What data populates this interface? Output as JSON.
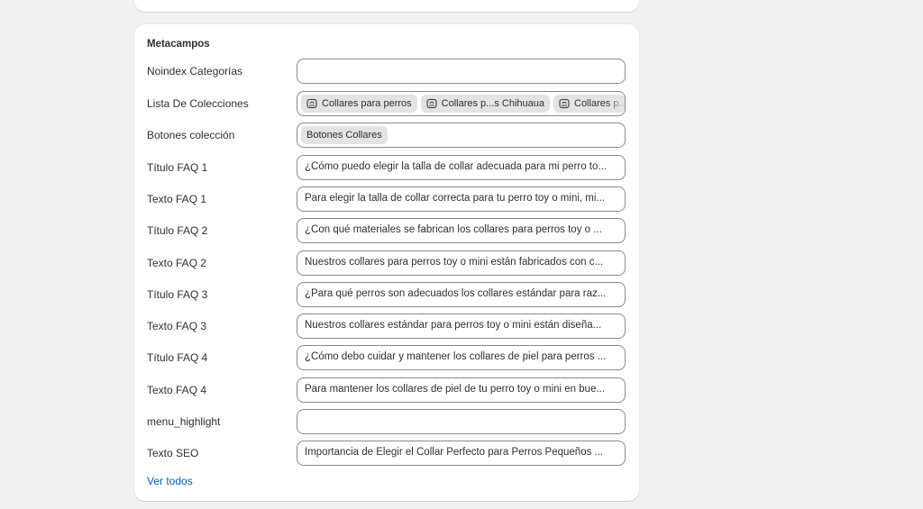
{
  "metafields": {
    "title": "Metacampos",
    "noindex": {
      "label": "Noindex Categorías",
      "value": ""
    },
    "collections": {
      "label": "Lista De Colecciones",
      "chips": [
        "Collares para perros",
        "Collares p...s Chihuaua",
        "Collares p..."
      ]
    },
    "buttons": {
      "label": "Botones colección",
      "chips": [
        "Botones Collares"
      ]
    },
    "faq": [
      {
        "label": "Título FAQ 1",
        "value": "¿Cómo puedo elegir la talla de collar adecuada para mi perro to..."
      },
      {
        "label": "Texto FAQ 1",
        "value": "Para elegir la talla de collar correcta para tu perro toy o mini, mi..."
      },
      {
        "label": "Título FAQ 2",
        "value": "¿Con qué materiales se fabrican los collares para perros toy o ..."
      },
      {
        "label": "Texto FAQ 2",
        "value": "Nuestros collares para perros toy o mini están fabricados con c..."
      },
      {
        "label": "Título FAQ 3",
        "value": "¿Para qué perros son adecuados los collares estándar para raz..."
      },
      {
        "label": "Texto FAQ 3",
        "value": "Nuestros collares estándar para perros toy o mini están diseña..."
      },
      {
        "label": "Título FAQ 4",
        "value": "¿Cómo debo cuidar y mantener los collares de piel para perros ..."
      },
      {
        "label": "Texto FAQ 4",
        "value": "Para mantener los collares de piel de tu perro toy o mini en bue..."
      }
    ],
    "menu_highlight": {
      "label": "menu_highlight",
      "value": ""
    },
    "seo": {
      "label": "Texto SEO",
      "value": "Importancia de Elegir el Collar Perfecto para Perros Pequeños ..."
    },
    "view_all": "Ver todos"
  },
  "icons": {
    "collection_chip": "collection-icon"
  },
  "colors": {
    "link": "#005bd3",
    "chip_bg": "#e3e3e3",
    "border": "#8a8a8a"
  }
}
